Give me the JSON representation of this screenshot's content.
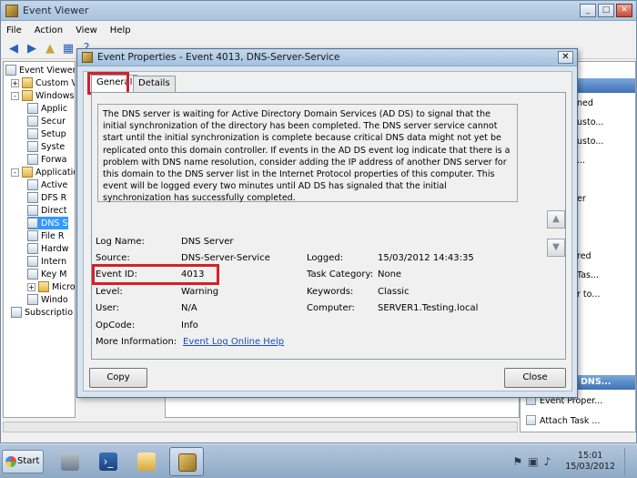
{
  "main_window": {
    "title": "Event Viewer",
    "menu": [
      "File",
      "Action",
      "View",
      "Help"
    ],
    "tree": [
      {
        "label": "Event Viewer",
        "expand": "",
        "icon": "event-viewer-icon"
      },
      {
        "label": "Custom V",
        "expand": "+",
        "icon": "folder-icon"
      },
      {
        "label": "Windows",
        "expand": "-",
        "icon": "folder-icon"
      },
      {
        "label": "Applic",
        "expand": "",
        "icon": "log-icon"
      },
      {
        "label": "Secur",
        "expand": "",
        "icon": "log-icon"
      },
      {
        "label": "Setup",
        "expand": "",
        "icon": "log-icon"
      },
      {
        "label": "Syste",
        "expand": "",
        "icon": "log-icon"
      },
      {
        "label": "Forwa",
        "expand": "",
        "icon": "log-icon"
      },
      {
        "label": "Applicatio",
        "expand": "-",
        "icon": "folder-icon"
      },
      {
        "label": "Active",
        "expand": "",
        "icon": "log-icon"
      },
      {
        "label": "DFS R",
        "expand": "",
        "icon": "log-icon"
      },
      {
        "label": "Direct",
        "expand": "",
        "icon": "log-icon"
      },
      {
        "label": "DNS S",
        "expand": "",
        "icon": "log-icon"
      },
      {
        "label": "File R",
        "expand": "",
        "icon": "log-icon"
      },
      {
        "label": "Hardw",
        "expand": "",
        "icon": "log-icon"
      },
      {
        "label": "Intern",
        "expand": "",
        "icon": "log-icon"
      },
      {
        "label": "Key M",
        "expand": "",
        "icon": "log-icon"
      },
      {
        "label": "Micros",
        "expand": "+",
        "icon": "folder-icon"
      },
      {
        "label": "Windo",
        "expand": "",
        "icon": "log-icon"
      },
      {
        "label": "Subscriptio",
        "expand": "",
        "icon": "subscription-icon"
      }
    ],
    "actions": {
      "items_top": [
        "ned",
        "usto...",
        "usto...",
        "...",
        "",
        "er",
        "",
        "",
        "red",
        "Tas...",
        "r to..."
      ],
      "header2": "DNS...",
      "items_bottom": [
        "Event Proper...",
        "Attach Task ..."
      ]
    }
  },
  "dialog": {
    "title": "Event Properties - Event 4013, DNS-Server-Service",
    "close_glyph": "✕",
    "tabs": {
      "general": "General",
      "details": "Details"
    },
    "description": "The DNS server is waiting for Active Directory Domain Services (AD DS) to signal that the initial synchronization of the directory has been completed. The DNS server service cannot start until the initial synchronization is complete because critical DNS data might not yet be replicated onto this domain controller. If events in the AD DS event log indicate that there is a problem with DNS name resolution, consider adding the IP address of another DNS server for this domain to the DNS server list in the Internet Protocol properties of this computer. This event will be logged every two minutes until AD DS has signaled that the initial synchronization has successfully completed.",
    "fields": {
      "log_name_label": "Log Name:",
      "log_name": "DNS Server",
      "source_label": "Source:",
      "source": "DNS-Server-Service",
      "logged_label": "Logged:",
      "logged": "15/03/2012 14:43:35",
      "event_id_label": "Event ID:",
      "event_id": "4013",
      "task_category_label": "Task Category:",
      "task_category": "None",
      "level_label": "Level:",
      "level": "Warning",
      "keywords_label": "Keywords:",
      "keywords": "Classic",
      "user_label": "User:",
      "user": "N/A",
      "computer_label": "Computer:",
      "computer": "SERVER1.Testing.local",
      "opcode_label": "OpCode:",
      "opcode": "Info",
      "more_info_label": "More Information:",
      "more_info_link": "Event Log Online Help"
    },
    "buttons": {
      "copy": "Copy",
      "close": "Close"
    }
  },
  "taskbar": {
    "start": "Start",
    "time": "15:01",
    "date": "15/03/2012"
  },
  "highlight_color": "#d4202a"
}
